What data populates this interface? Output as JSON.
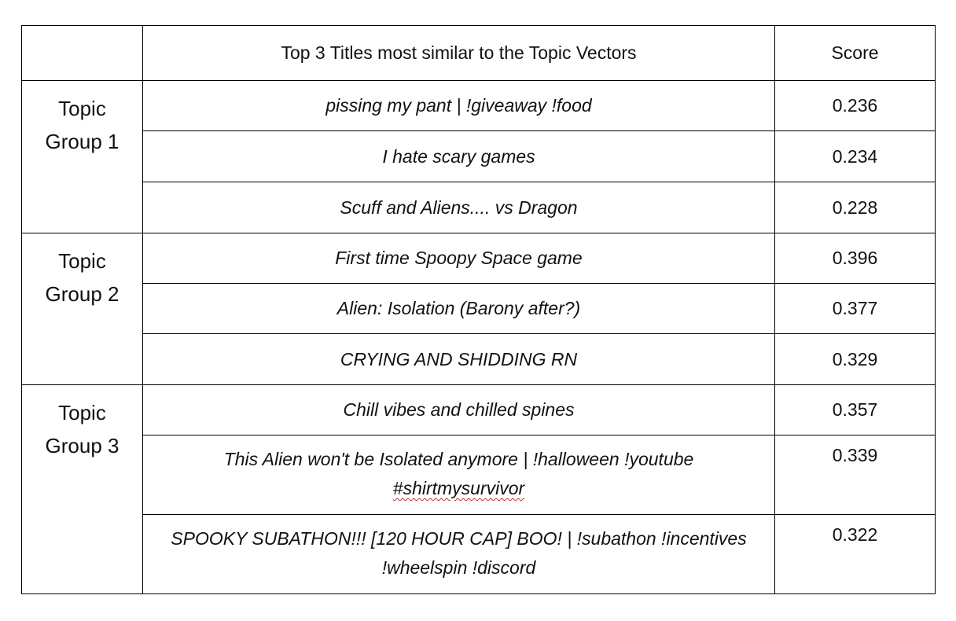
{
  "table": {
    "header": {
      "group": "",
      "title": "Top 3 Titles most similar to the Topic Vectors",
      "score": "Score"
    },
    "groups": [
      {
        "label_line1": "Topic",
        "label_line2": "Group 1",
        "rows": [
          {
            "title": "pissing my pant | !giveaway !food",
            "score": "0.236"
          },
          {
            "title": "I hate scary games",
            "score": "0.234"
          },
          {
            "title": "Scuff and Aliens.... vs Dragon",
            "score": "0.228"
          }
        ]
      },
      {
        "label_line1": "Topic",
        "label_line2": "Group 2",
        "rows": [
          {
            "title": "First time Spoopy Space game",
            "score": "0.396"
          },
          {
            "title": "Alien: Isolation (Barony after?)",
            "score": "0.377"
          },
          {
            "title": "CRYING AND SHIDDING RN",
            "score": "0.329"
          }
        ]
      },
      {
        "label_line1": "Topic",
        "label_line2": "Group 3",
        "rows": [
          {
            "title": "Chill vibes and chilled spines",
            "score": "0.357"
          },
          {
            "title_line1": "This Alien won't be Isolated anymore | !halloween !youtube",
            "title_line2": "#shirtmysurvivor",
            "score": "0.339"
          },
          {
            "title_line1": "SPOOKY SUBATHON!!! [120 HOUR CAP] BOO! | !subathon !incentives",
            "title_line2": "!wheelspin !discord",
            "score": "0.322"
          }
        ]
      }
    ]
  }
}
